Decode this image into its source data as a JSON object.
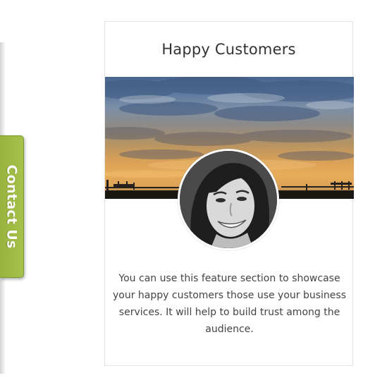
{
  "contact_tab": {
    "label": "Contact Us",
    "color": "#a3bf46"
  },
  "feature_card": {
    "title": "Happy Customers",
    "description": "You can use this feature section to showcase your happy customers those use your business services. It will help to build trust among the audience.",
    "banner_icon": "sunset-sky-banner",
    "avatar_icon": "customer-avatar"
  }
}
